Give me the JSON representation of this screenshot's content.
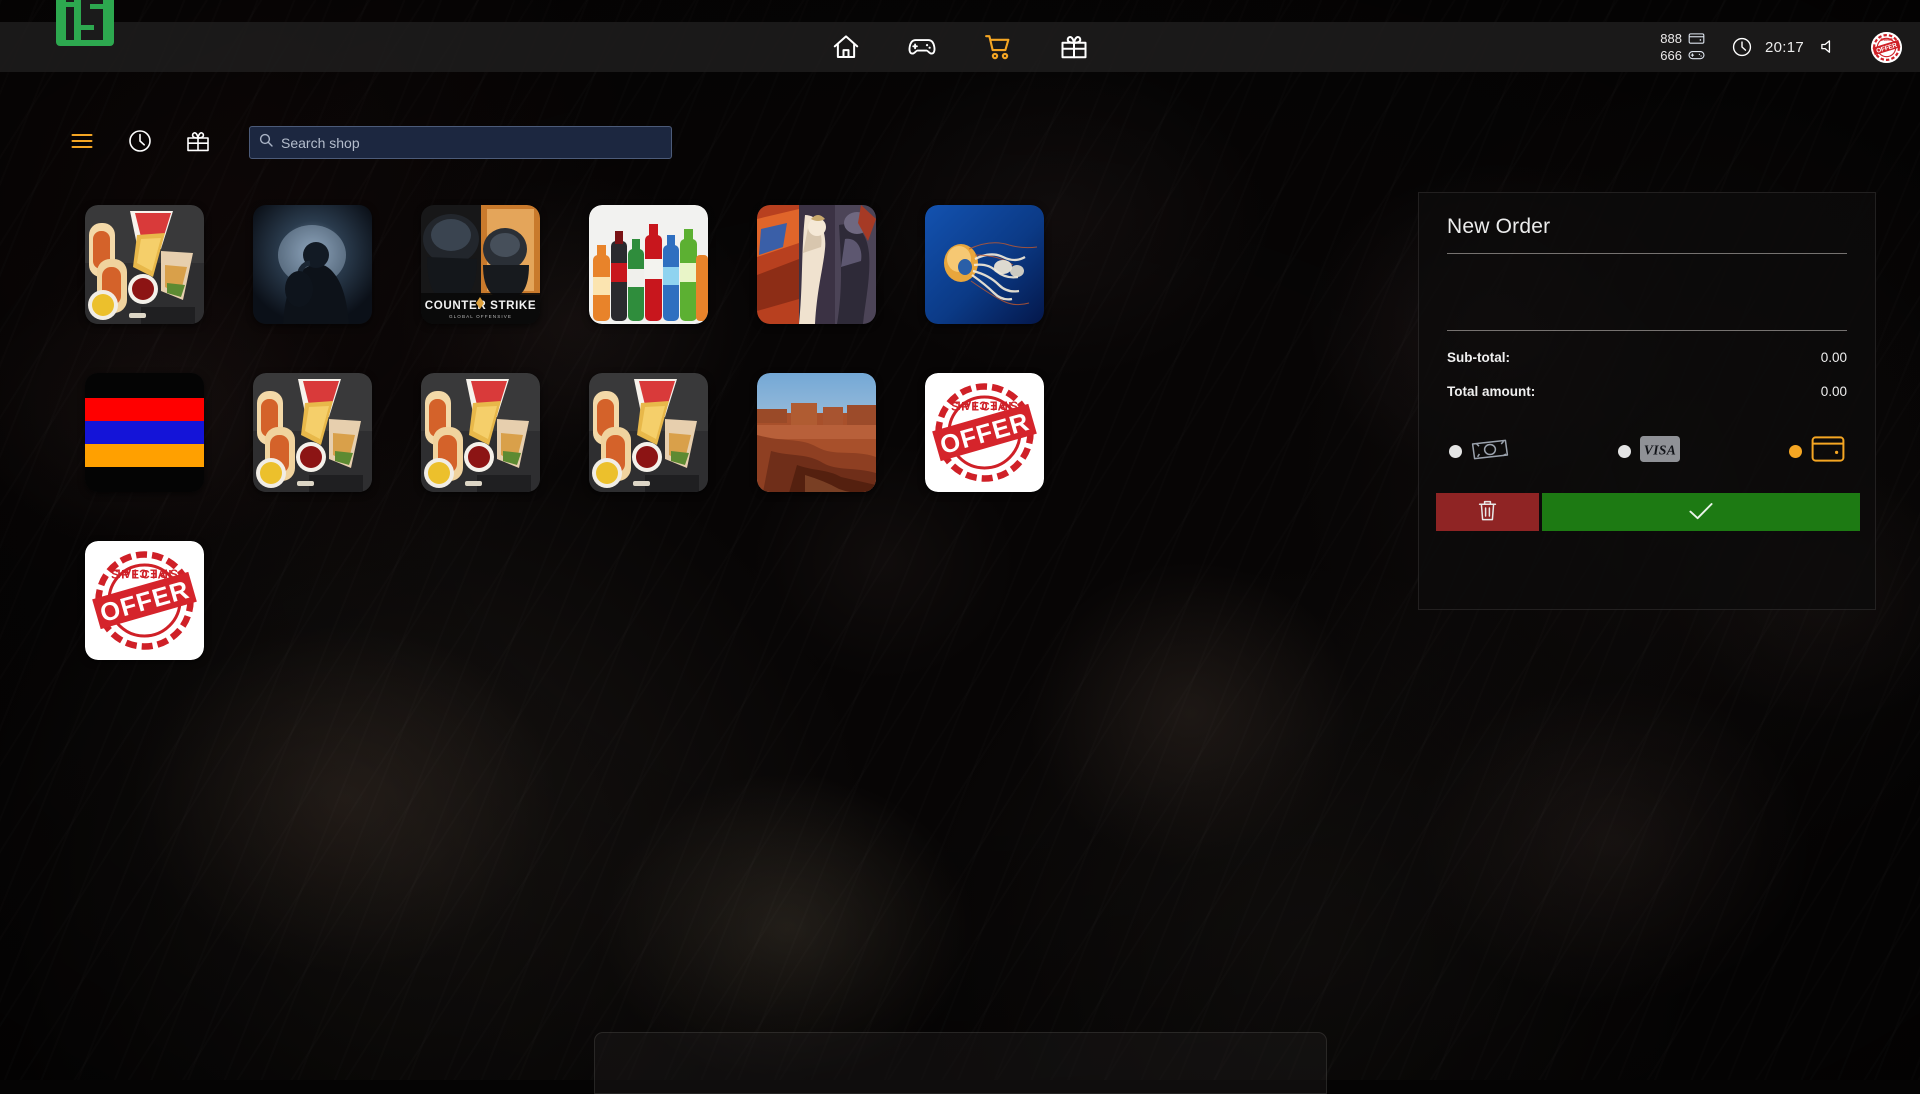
{
  "app": {
    "logo_alt": "i2-logo",
    "background_theme": "dark-animatronic-wallpaper"
  },
  "topbar": {
    "nav_items": [
      {
        "name": "home",
        "icon": "home-icon",
        "active": false
      },
      {
        "name": "games",
        "icon": "gamepad-icon",
        "active": false
      },
      {
        "name": "shop",
        "icon": "cart-icon",
        "active": true
      },
      {
        "name": "gifts",
        "icon": "gift-icon",
        "active": false
      }
    ],
    "stats": [
      {
        "value": "888",
        "icon": "wallet-icon"
      },
      {
        "value": "666",
        "icon": "gamepad-small-icon"
      }
    ],
    "clock_icon": "clock-icon",
    "time": "20:17",
    "sound_icon": "speaker-icon",
    "avatar_alt": "special-offer-avatar"
  },
  "toolbar": {
    "menu_icon": "hamburger-icon",
    "history_icon": "clock-icon",
    "gift_icon": "gift-icon"
  },
  "search": {
    "placeholder": "Search shop",
    "value": "",
    "icon": "search-icon"
  },
  "catalog": {
    "items": [
      {
        "id": 1,
        "name": "fastfood-hotdogs",
        "art": "food"
      },
      {
        "id": 2,
        "name": "dark-shooter-game",
        "art": "darkgame"
      },
      {
        "id": 3,
        "name": "counter-strike",
        "art": "cs",
        "label": "COUNTER STRIKE",
        "sublabel": "GLOBAL OFFENSIVE"
      },
      {
        "id": 4,
        "name": "soda-bottles",
        "art": "soda"
      },
      {
        "id": 5,
        "name": "anime-game-art",
        "art": "anime"
      },
      {
        "id": 6,
        "name": "jellyfish",
        "art": "jellyfish"
      },
      {
        "id": 7,
        "name": "armenia-flag",
        "art": "flag"
      },
      {
        "id": 8,
        "name": "fastfood-hotdogs",
        "art": "food"
      },
      {
        "id": 9,
        "name": "fastfood-hotdogs",
        "art": "food"
      },
      {
        "id": 10,
        "name": "fastfood-hotdogs",
        "art": "food"
      },
      {
        "id": 11,
        "name": "desert-canyon",
        "art": "canyon"
      },
      {
        "id": 12,
        "name": "special-offer",
        "art": "offer",
        "label": "OFFER",
        "sublabel": "SPECIAL"
      },
      {
        "id": 13,
        "name": "special-offer",
        "art": "offer",
        "label": "OFFER",
        "sublabel": "SPECIAL"
      }
    ]
  },
  "order": {
    "title": "New Order",
    "items": [],
    "subtotal_label": "Sub-total:",
    "subtotal_value": "0.00",
    "total_label": "Total amount:",
    "total_value": "0.00",
    "payment_methods": [
      {
        "name": "cash",
        "icon": "banknote-icon",
        "selected": false
      },
      {
        "name": "card",
        "icon": "visa-icon",
        "label": "VISA",
        "selected": false
      },
      {
        "name": "wallet",
        "icon": "wallet-icon",
        "selected": true
      }
    ],
    "delete_button": {
      "name": "delete-order",
      "icon": "trash-icon"
    },
    "confirm_button": {
      "name": "confirm-order",
      "icon": "check-icon"
    }
  },
  "colors": {
    "accent_orange": "#f5a623",
    "brand_green": "#2da84f",
    "confirm_green": "#1d7a13",
    "delete_red": "#8f2424",
    "panel_bg": "#0c0b0b",
    "search_bg": "#1c2740"
  }
}
